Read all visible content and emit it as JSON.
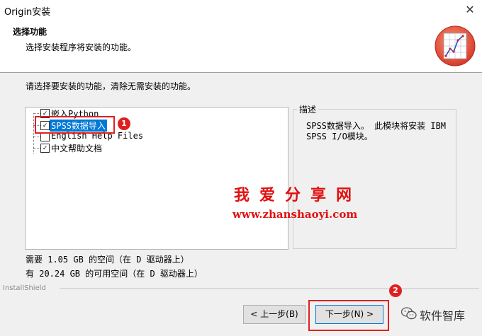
{
  "window": {
    "title": "Origin安装",
    "close_icon": "close-icon"
  },
  "header": {
    "title": "选择功能",
    "subtitle": "选择安装程序将安装的功能。",
    "logo_icon": "origin-chart-logo-icon"
  },
  "instruction": "请选择要安装的功能，清除无需安装的功能。",
  "features": [
    {
      "label": "嵌入Python",
      "checked": true,
      "selected": false
    },
    {
      "label": "SPSS数据导入",
      "checked": true,
      "selected": true
    },
    {
      "label": "English Help Files",
      "checked": false,
      "selected": false
    },
    {
      "label": "中文帮助文档",
      "checked": true,
      "selected": false
    }
  ],
  "description": {
    "title": "描述",
    "text": "SPSS数据导入。 此模块将安装 IBM SPSS I/O模块。"
  },
  "space": {
    "required": "需要 1.05 GB 的空间（在 D 驱动器上）",
    "available": "有 20.24 GB 的可用空间（在 D 驱动器上）"
  },
  "installshield": "InstallShield",
  "buttons": {
    "back": "< 上一步(B)",
    "next": "下一步(N) >"
  },
  "annotations": {
    "badge1": "1",
    "badge2": "2"
  },
  "watermark": {
    "cn": "我爱分享网",
    "url": "www.zhanshaoyi.com"
  },
  "wechat": {
    "label": "软件智库",
    "icon": "wechat-icon"
  },
  "colors": {
    "selection": "#0078d7",
    "highlight": "#e02020",
    "watermark": "#e01010"
  }
}
